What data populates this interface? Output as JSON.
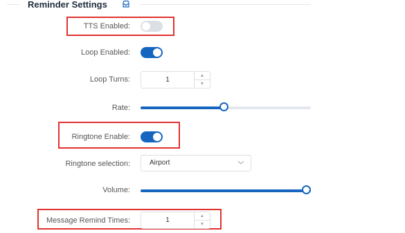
{
  "section": {
    "title": "Reminder Settings",
    "icon": "inbox-icon"
  },
  "tts": {
    "label": "TTS Enabled:",
    "on": false
  },
  "loop": {
    "label": "Loop Enabled:",
    "on": true
  },
  "loop_turns": {
    "label": "Loop Turns:",
    "value": "1"
  },
  "rate": {
    "label": "Rate:",
    "fraction": 0.49
  },
  "ringtone_enable": {
    "label": "Ringtone Enable:",
    "on": true
  },
  "ringtone_selection": {
    "label": "Ringtone selection:",
    "value": "Airport"
  },
  "volume": {
    "label": "Volume:",
    "fraction": 1.0
  },
  "message_remind": {
    "label": "Message Remind Times:",
    "value": "1"
  },
  "colors": {
    "accent": "#1565c0",
    "highlight": "#e0312e"
  }
}
